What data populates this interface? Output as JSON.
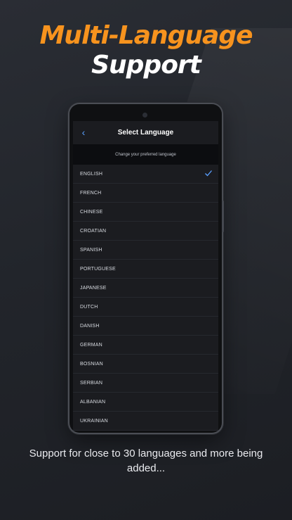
{
  "headline": {
    "line1": "Multi-Language",
    "line2": "Support"
  },
  "colors": {
    "accent": "#f7931e",
    "check": "#5aa0ff"
  },
  "app": {
    "title": "Select Language",
    "back_icon": "chevron-left-icon",
    "subtitle": "Change your preferred language",
    "selected": "ENGLISH",
    "languages": [
      "ENGLISH",
      "FRENCH",
      "CHINESE",
      "CROATIAN",
      "SPANISH",
      "PORTUGUESE",
      "JAPANESE",
      "DUTCH",
      "DANISH",
      "GERMAN",
      "BOSNIAN",
      "SERBIAN",
      "ALBANIAN",
      "UKRAINIAN"
    ]
  },
  "caption": "Support for close to 30 languages and more being added..."
}
